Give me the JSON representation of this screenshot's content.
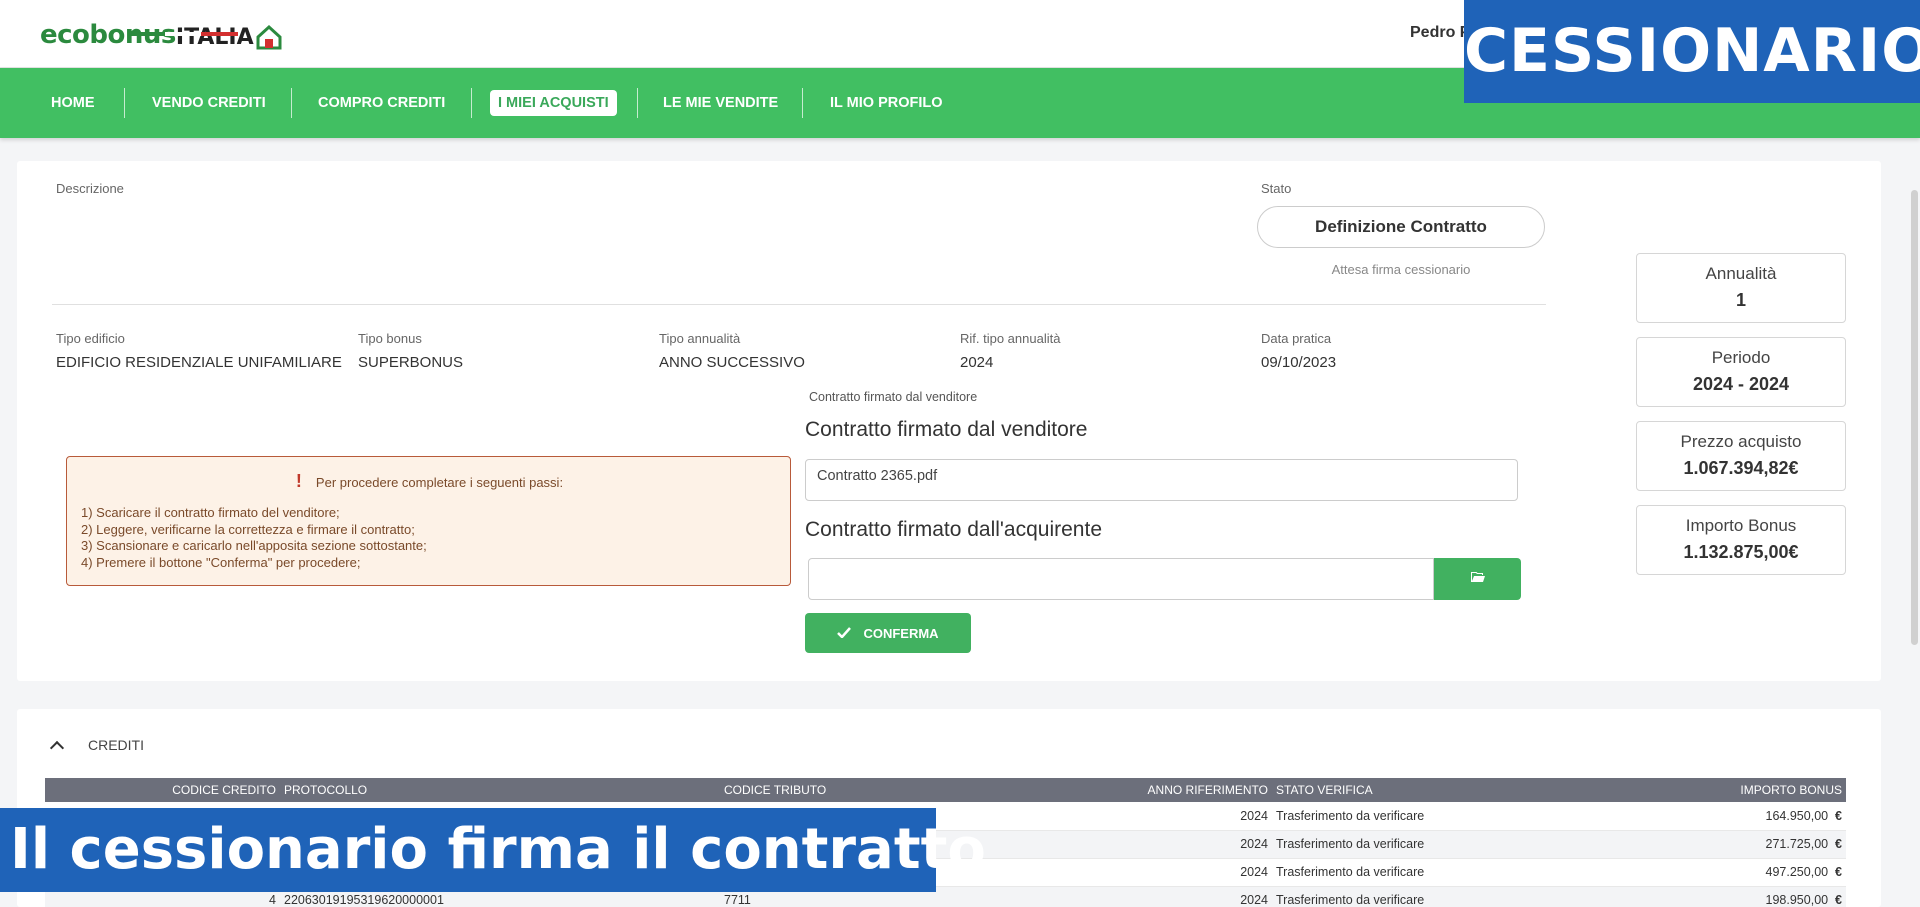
{
  "header": {
    "logo_eco": "ecobonus",
    "logo_italia": "ITALIA",
    "user_name": "Pedro P"
  },
  "nav": {
    "items": [
      {
        "label": "HOME"
      },
      {
        "label": "VENDO CREDITI"
      },
      {
        "label": "COMPRO CREDITI"
      },
      {
        "label": "I MIEI ACQUISTI"
      },
      {
        "label": "LE MIE VENDITE"
      },
      {
        "label": "IL MIO PROFILO"
      }
    ],
    "active_index": 3
  },
  "overlay": {
    "badge": "CESSIONARIO",
    "caption": "Il cessionario firma il contratto"
  },
  "pratica": {
    "descrizione_label": "Descrizione",
    "stato_label": "Stato",
    "stato_value": "Definizione Contratto",
    "stato_sub": "Attesa firma cessionario",
    "fields": [
      {
        "label": "Tipo edificio",
        "value": "EDIFICIO RESIDENZIALE UNIFAMILIARE"
      },
      {
        "label": "Tipo bonus",
        "value": "SUPERBONUS"
      },
      {
        "label": "Tipo annualità",
        "value": "ANNO SUCCESSIVO"
      },
      {
        "label": "Rif. tipo annualità",
        "value": "2024"
      },
      {
        "label": "Data pratica",
        "value": "09/10/2023"
      }
    ]
  },
  "summary": [
    {
      "label": "Annualità",
      "value": "1"
    },
    {
      "label": "Periodo",
      "value": "2024 - 2024"
    },
    {
      "label": "Prezzo acquisto",
      "value": "1.067.394,82€"
    },
    {
      "label": "Importo Bonus",
      "value": "1.132.875,00€"
    }
  ],
  "warning": {
    "title": "Per procedere completare i seguenti passi:",
    "steps": [
      "1) Scaricare il contratto firmato del venditore;",
      "2) Leggere, verificarne la correttezza e firmare il contratto;",
      "3) Scansionare e caricarlo nell'apposita sezione sottostante;",
      "4) Premere il bottone \"Conferma\" per procedere;"
    ]
  },
  "contratto": {
    "small_label": "Contratto firmato dal venditore",
    "venditore_heading": "Contratto firmato dal venditore",
    "venditore_file": "Contratto 2365.pdf",
    "acquirente_heading": "Contratto firmato dall'acquirente",
    "acquirente_file": "",
    "confirm_label": "CONFERMA"
  },
  "crediti": {
    "title": "CREDITI",
    "columns": [
      "CODICE CREDITO",
      "PROTOCOLLO",
      "CODICE TRIBUTO",
      "ANNO RIFERIMENTO",
      "STATO VERIFICA",
      "IMPORTO BONUS"
    ],
    "rows": [
      {
        "codice": "",
        "protocollo": "",
        "tributo": "",
        "anno": "2024",
        "stato": "Trasferimento da verificare",
        "importo": "164.950,00",
        "valuta": "€"
      },
      {
        "codice": "",
        "protocollo": "",
        "tributo": "",
        "anno": "2024",
        "stato": "Trasferimento da verificare",
        "importo": "271.725,00",
        "valuta": "€"
      },
      {
        "codice": "",
        "protocollo": "",
        "tributo": "",
        "anno": "2024",
        "stato": "Trasferimento da verificare",
        "importo": "497.250,00",
        "valuta": "€"
      },
      {
        "codice": "4",
        "protocollo": "22063019195319620000001",
        "tributo": "7711",
        "anno": "2024",
        "stato": "Trasferimento da verificare",
        "importo": "198.950,00",
        "valuta": "€"
      }
    ]
  }
}
